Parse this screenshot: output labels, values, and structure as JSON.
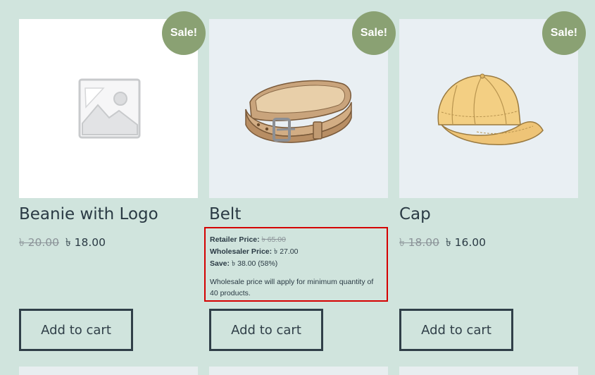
{
  "currency_symbol": "৳",
  "colors": {
    "background": "#d0e4dd",
    "sale_badge": "#8aa173",
    "highlight_border": "#d40000",
    "button_border": "#303f48"
  },
  "products": [
    {
      "name": "Beanie with Logo",
      "sale_badge": "Sale!",
      "image": "placeholder-image-icon",
      "old_price": "৳ 20.00",
      "new_price": "৳ 18.00",
      "button_label": "Add to cart"
    },
    {
      "name": "Belt",
      "sale_badge": "Sale!",
      "image": "belt-image",
      "wholesale": {
        "retailer_label": "Retailer Price:",
        "retailer_price": "৳ 65.00",
        "wholesaler_label": "Wholesaler Price:",
        "wholesaler_price": "৳ 27.00",
        "save_label": "Save:",
        "save_value": "৳ 38.00 (58%)",
        "note": "Wholesale price will apply for minimum quantity of 40 products."
      },
      "button_label": "Add to cart"
    },
    {
      "name": "Cap",
      "sale_badge": "Sale!",
      "image": "cap-image",
      "old_price": "৳ 18.00",
      "new_price": "৳ 16.00",
      "button_label": "Add to cart"
    }
  ]
}
